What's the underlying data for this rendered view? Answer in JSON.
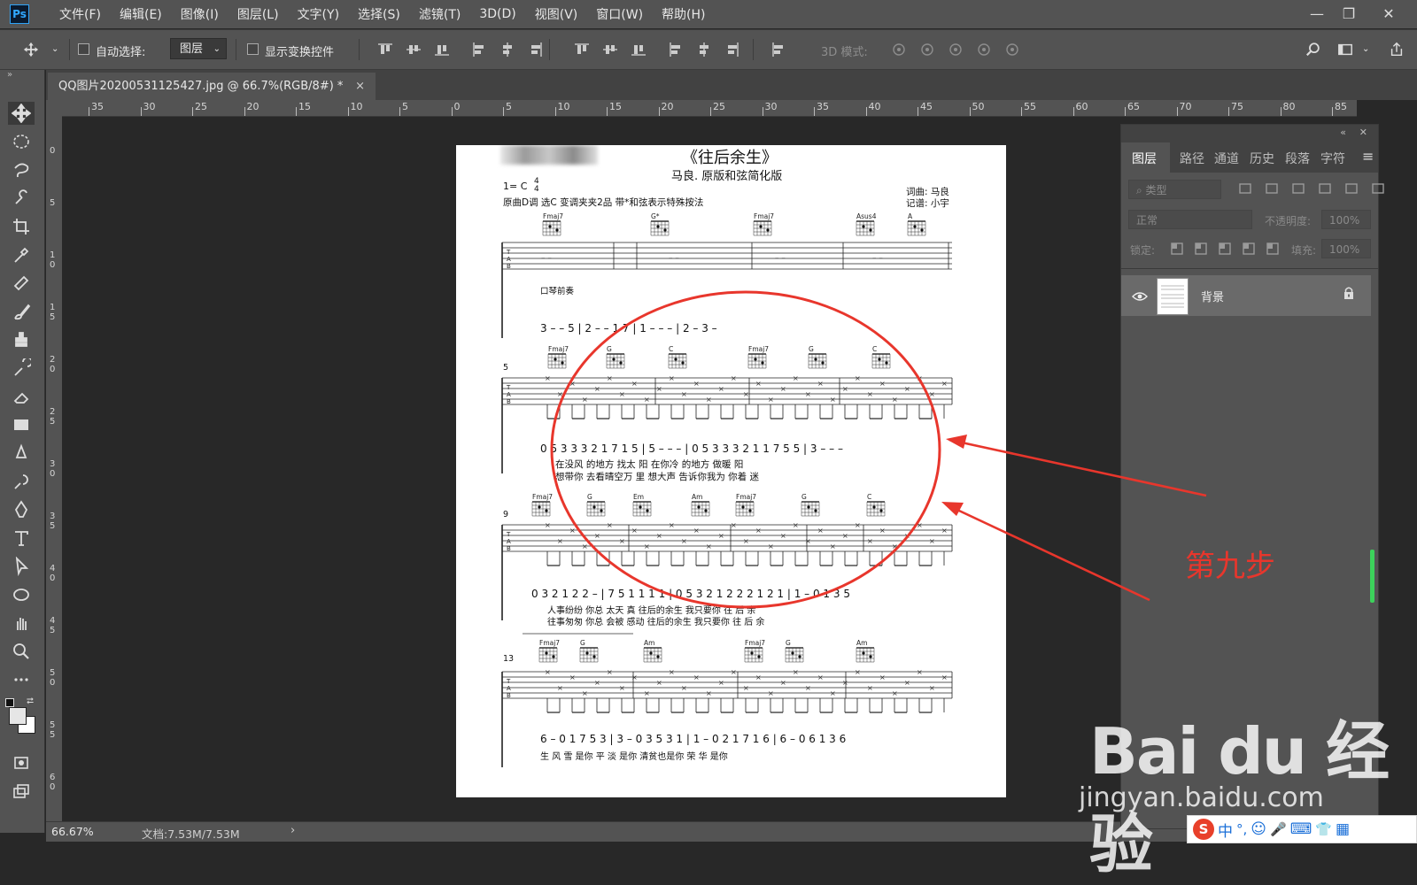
{
  "app": {
    "logo": "Ps"
  },
  "menu": [
    "文件(F)",
    "编辑(E)",
    "图像(I)",
    "图层(L)",
    "文字(Y)",
    "选择(S)",
    "滤镜(T)",
    "3D(D)",
    "视图(V)",
    "窗口(W)",
    "帮助(H)"
  ],
  "window_controls": {
    "minimize": "—",
    "restore": "❐",
    "close": "✕"
  },
  "options": {
    "auto_select_label": "自动选择:",
    "auto_select_value": "图层",
    "show_transform_label": "显示变换控件",
    "mode_3d_label": "3D 模式:"
  },
  "document_tab": {
    "title": "QQ图片20200531125427.jpg @ 66.7%(RGB/8#) *",
    "close": "×"
  },
  "ruler": {
    "h_labels": [
      "35",
      "30",
      "25",
      "20",
      "15",
      "10",
      "5",
      "0",
      "5",
      "10",
      "15",
      "20",
      "25",
      "30",
      "35",
      "40",
      "45",
      "50",
      "55",
      "60",
      "65",
      "70",
      "75",
      "80",
      "85"
    ],
    "v_labels": [
      "0",
      "5",
      "10",
      "15",
      "20",
      "25",
      "30",
      "35",
      "40",
      "45",
      "50",
      "55",
      "60"
    ]
  },
  "status": {
    "zoom": "66.67%",
    "doc": "文档:7.53M/7.53M",
    "arrow": "›"
  },
  "panel": {
    "tabs": [
      "图层",
      "路径",
      "通道",
      "历史",
      "段落",
      "字符"
    ],
    "filter_placeholder": "类型",
    "blend_mode": "正常",
    "opacity_label": "不透明度:",
    "opacity_value": "100%",
    "lock_label": "锁定:",
    "fill_label": "填充:",
    "fill_value": "100%",
    "layer_name": "背景"
  },
  "sheet": {
    "title": "《往后余生》",
    "subtitle": "马良. 原版和弦简化版",
    "key": "1= C",
    "time_top": "4",
    "time_bottom": "4",
    "notes": "原曲D调  选C  变调夹夹2品  带*和弦表示特殊按法",
    "credit_lyrics": "词曲: 马良",
    "credit_transcriber": "记谱: 小宇",
    "intro_label": "口琴前奏",
    "measure_nums": [
      "5",
      "9",
      "13"
    ],
    "sys1_chords": [
      "Fmaj7",
      "G*",
      "Fmaj7",
      "Asus4",
      "A"
    ],
    "sys2_chords": [
      "Fmaj7",
      "G",
      "C",
      "Fmaj7",
      "G",
      "C"
    ],
    "sys3_chords": [
      "Fmaj7",
      "G",
      "Em",
      "Am",
      "Fmaj7",
      "G",
      "C"
    ],
    "sys4_chords": [
      "Fmaj7",
      "G",
      "Am",
      "Fmaj7",
      "G",
      "Am"
    ],
    "jianpu1": "3  –  –  5  |  2  –  –  1 7  |  1  –  –  –  |  2  –  3  –",
    "jianpu2": "0 5 3 3 3 2 1 7 1 5  |  5  –  –  –  |  0 5 3 3 3 2 1 1 7 5 5  |  3  –  –  –",
    "lyrics2a": "在没风 的地方 找太 阳                              在你冷 的地方    做暖        阳",
    "lyrics2b": "想带你 去看晴空万 里                              想大声 告诉你我为 你着       迷",
    "jianpu3": "0   3 2 1 2 2   –   |  7 5 1 1 1 1  |  0 5 3 2 1 2 2   2 1 2 1  |  1  –  0 1 3 5",
    "lyrics3a": "人事纷纷                 你总   太天 真                 往后的余生         我只要你                  往 后 余",
    "lyrics3b": "往事匆匆                 你总   会被 感动             往后的余生         我只要你                  往 后 余",
    "jianpu4": "6  –  0 1 7 5 3  |  3  –  0 3 5 3 1  |  1  –  0 2 1 7 1 6  |  6  –  0 6 1 3 6",
    "lyrics4": "生            风 雪 是你                  平 淡 是你                  清贫也是你                  荣 华 是你"
  },
  "annotation": {
    "label": "第九步",
    "color": "#e8362c"
  },
  "watermark": {
    "brand": "Bai du 经验",
    "url": "jingyan.baidu.com"
  },
  "ime": {
    "items": [
      "S",
      "中",
      "°,",
      "☺",
      "🎤",
      "⌨",
      "👕",
      "▦"
    ]
  }
}
